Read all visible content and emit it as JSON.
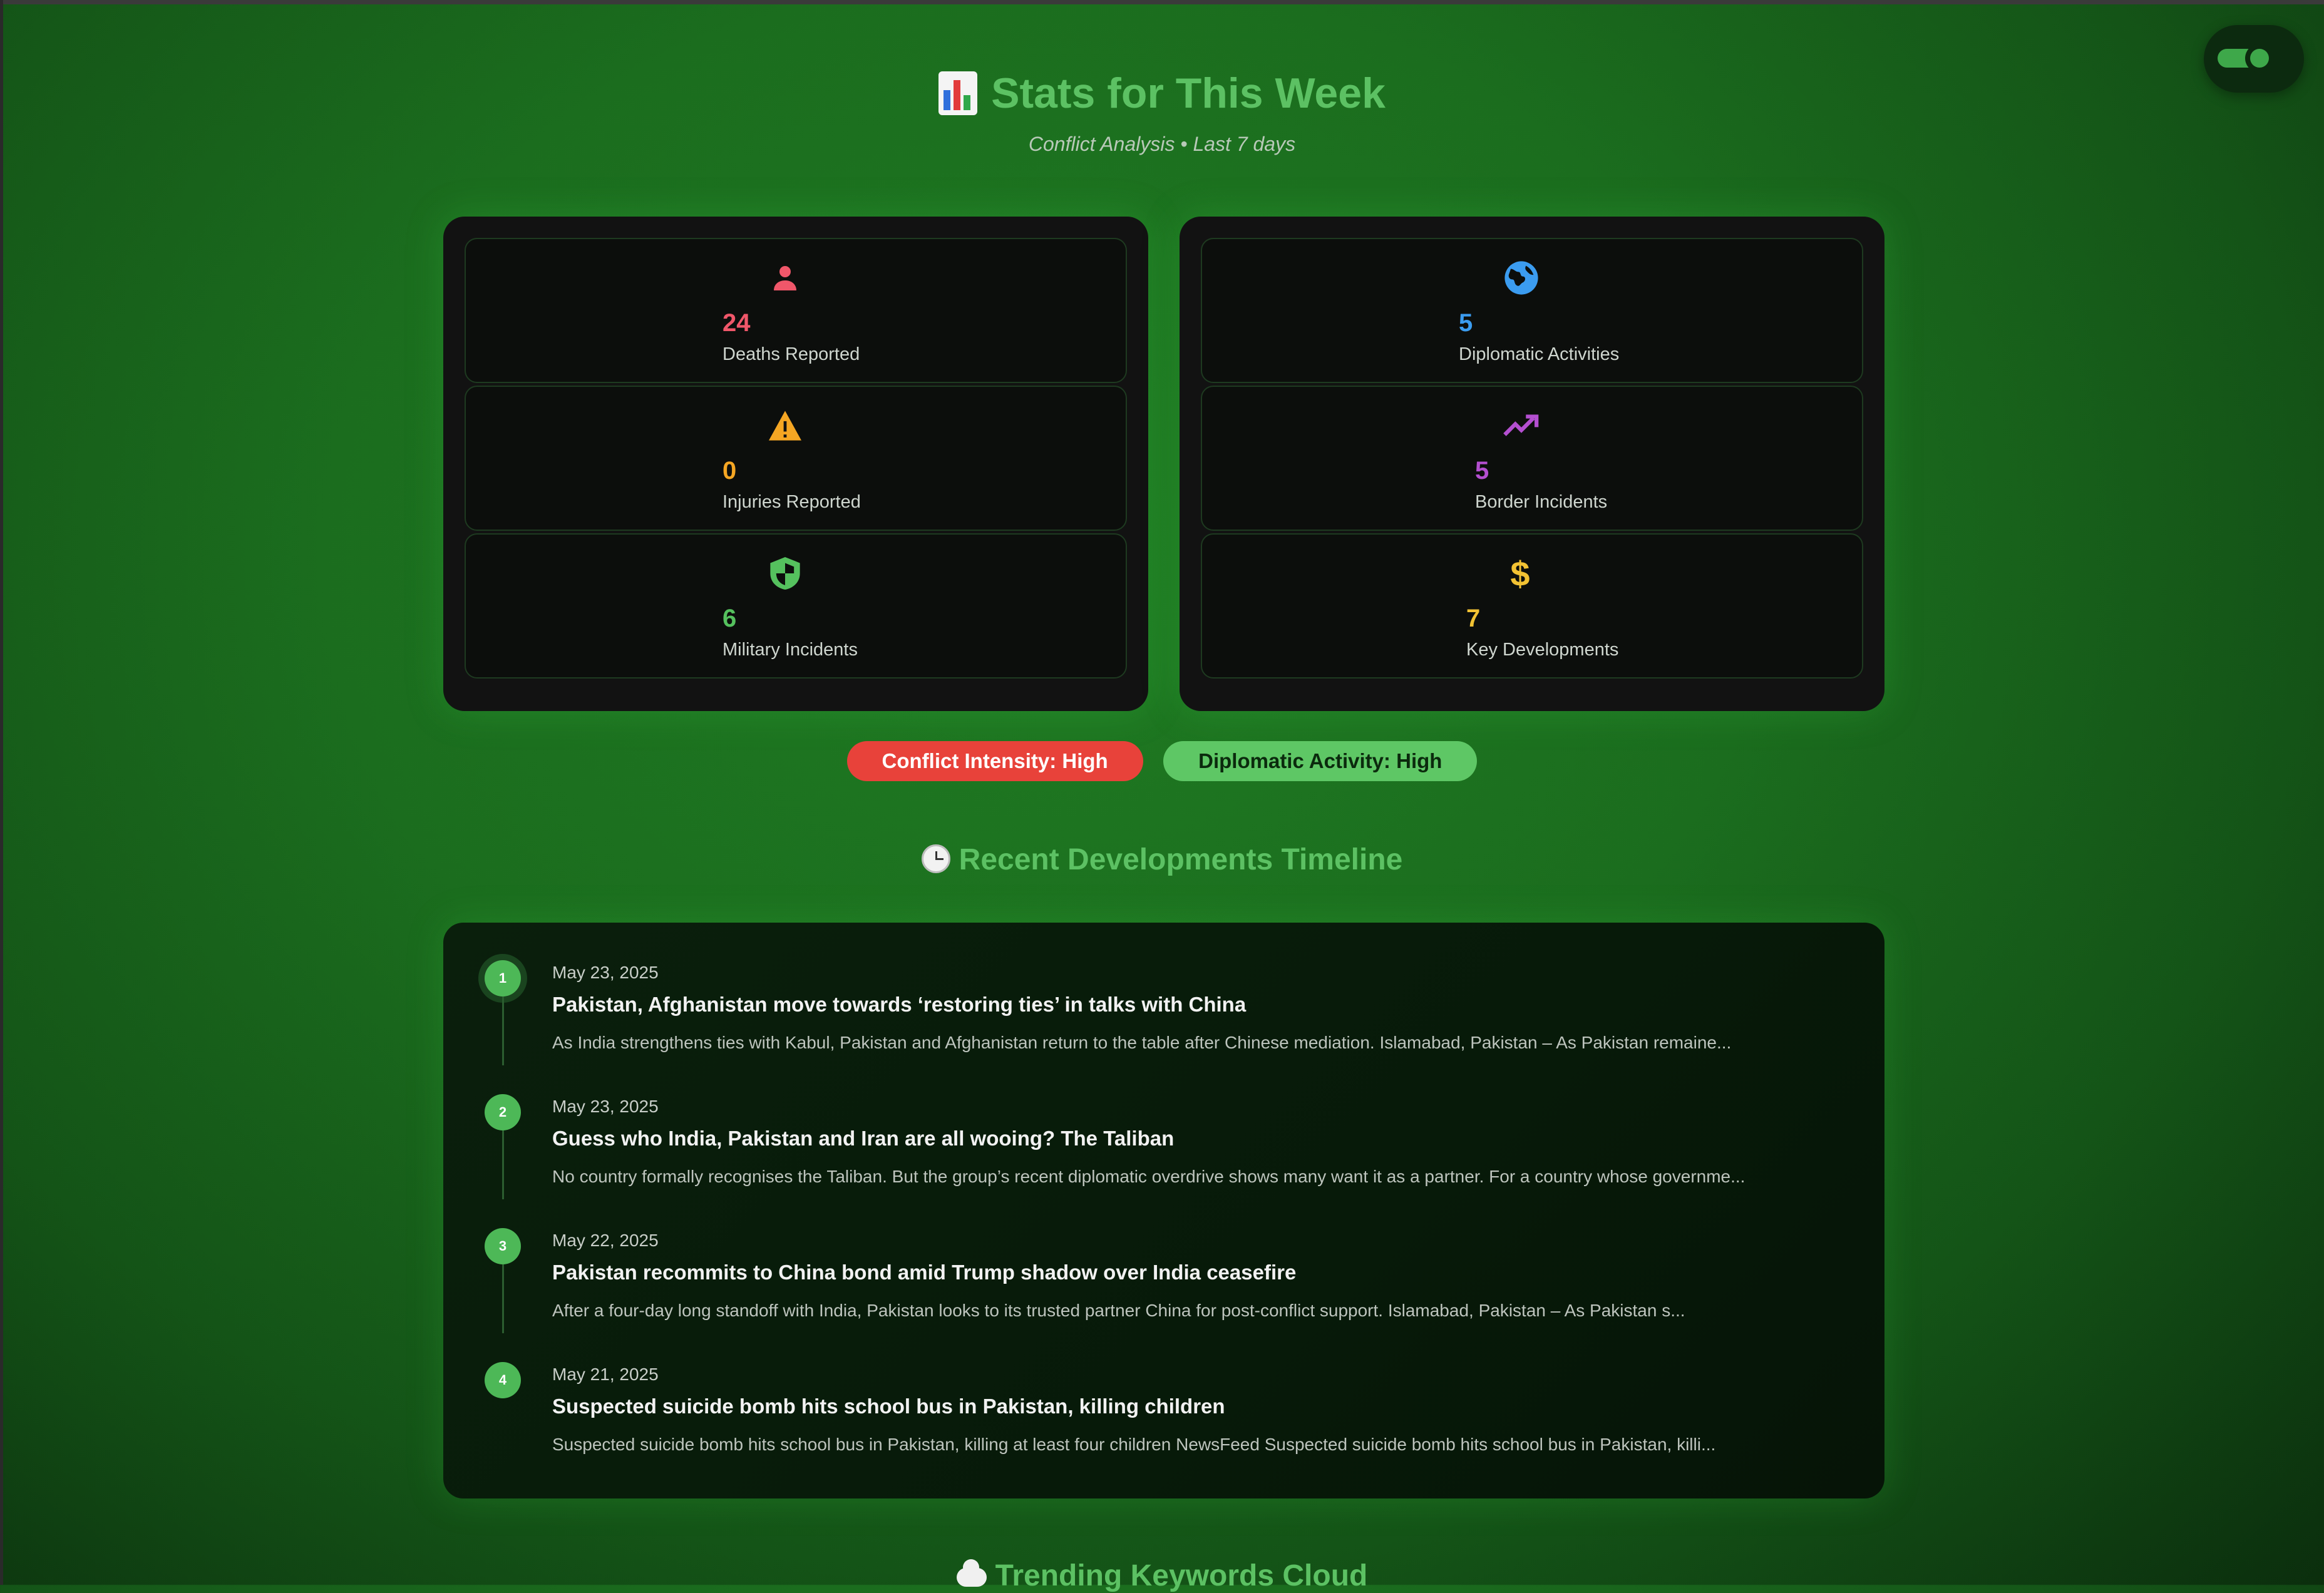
{
  "header": {
    "title": "Stats for This Week",
    "subtitle": "Conflict Analysis • Last 7 days"
  },
  "stats_left": [
    {
      "value": "24",
      "label": "Deaths Reported",
      "icon": "person-icon",
      "color": "#f0576a"
    },
    {
      "value": "0",
      "label": "Injuries Reported",
      "icon": "warning-icon",
      "color": "#f5a623"
    },
    {
      "value": "6",
      "label": "Military Incidents",
      "icon": "shield-icon",
      "color": "#55c15e"
    }
  ],
  "stats_right": [
    {
      "value": "5",
      "label": "Diplomatic Activities",
      "icon": "globe-icon",
      "color": "#3b9cf0"
    },
    {
      "value": "5",
      "label": "Border Incidents",
      "icon": "trending-up-icon",
      "color": "#b44fd0"
    },
    {
      "value": "7",
      "label": "Key Developments",
      "icon": "dollar-icon",
      "color": "#f2c233"
    }
  ],
  "badges": {
    "conflict": "Conflict Intensity: High",
    "diplomatic": "Diplomatic Activity: High"
  },
  "timeline": {
    "title": "Recent Developments Timeline",
    "items": [
      {
        "number": "1",
        "date": "May 23, 2025",
        "title": "Pakistan, Afghanistan move towards ‘restoring ties’ in talks with China",
        "description": "As India strengthens ties with Kabul, Pakistan and Afghanistan return to the table after Chinese mediation. Islamabad, Pakistan – As Pakistan remaine..."
      },
      {
        "number": "2",
        "date": "May 23, 2025",
        "title": "Guess who India, Pakistan and Iran are all wooing? The Taliban",
        "description": "No country formally recognises the Taliban. But the group’s recent diplomatic overdrive shows many want it as a partner. For a country whose governme..."
      },
      {
        "number": "3",
        "date": "May 22, 2025",
        "title": "Pakistan recommits to China bond amid Trump shadow over India ceasefire",
        "description": "After a four-day long standoff with India, Pakistan looks to its trusted partner China for post-conflict support. Islamabad, Pakistan – As Pakistan s..."
      },
      {
        "number": "4",
        "date": "May 21, 2025",
        "title": "Suspected suicide bomb hits school bus in Pakistan, killing children",
        "description": "Suspected suicide bomb hits school bus in Pakistan, killing at least four children NewsFeed Suspected suicide bomb hits school bus in Pakistan, killi..."
      }
    ]
  },
  "trending": {
    "title": "Trending Keywords Cloud"
  },
  "colors": {
    "accent": "#5cc163",
    "danger": "#e8423a",
    "success": "#5ec765"
  }
}
